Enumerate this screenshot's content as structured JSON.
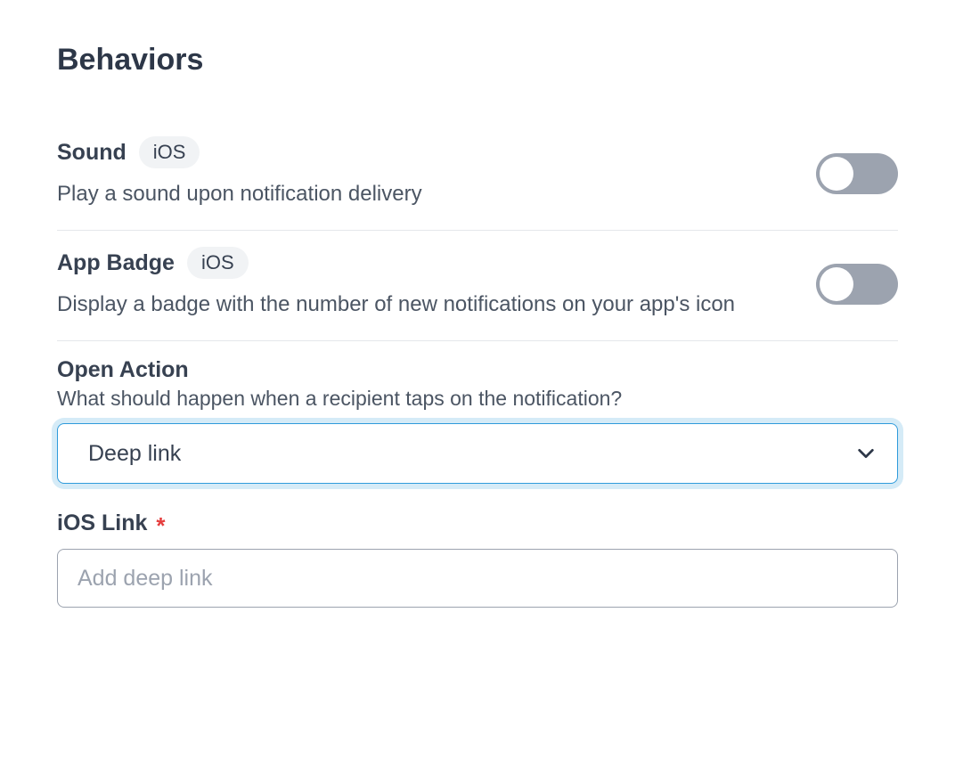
{
  "section": {
    "title": "Behaviors"
  },
  "sound": {
    "label": "Sound",
    "platform": "iOS",
    "description": "Play a sound upon notification delivery",
    "enabled": false
  },
  "appBadge": {
    "label": "App Badge",
    "platform": "iOS",
    "description": "Display a badge with the number of new notifications on your app's icon",
    "enabled": false
  },
  "openAction": {
    "label": "Open Action",
    "help": "What should happen when a recipient taps on the notification?",
    "selected": "Deep link"
  },
  "iosLink": {
    "label": "iOS Link",
    "required": true,
    "placeholder": "Add deep link",
    "value": ""
  }
}
